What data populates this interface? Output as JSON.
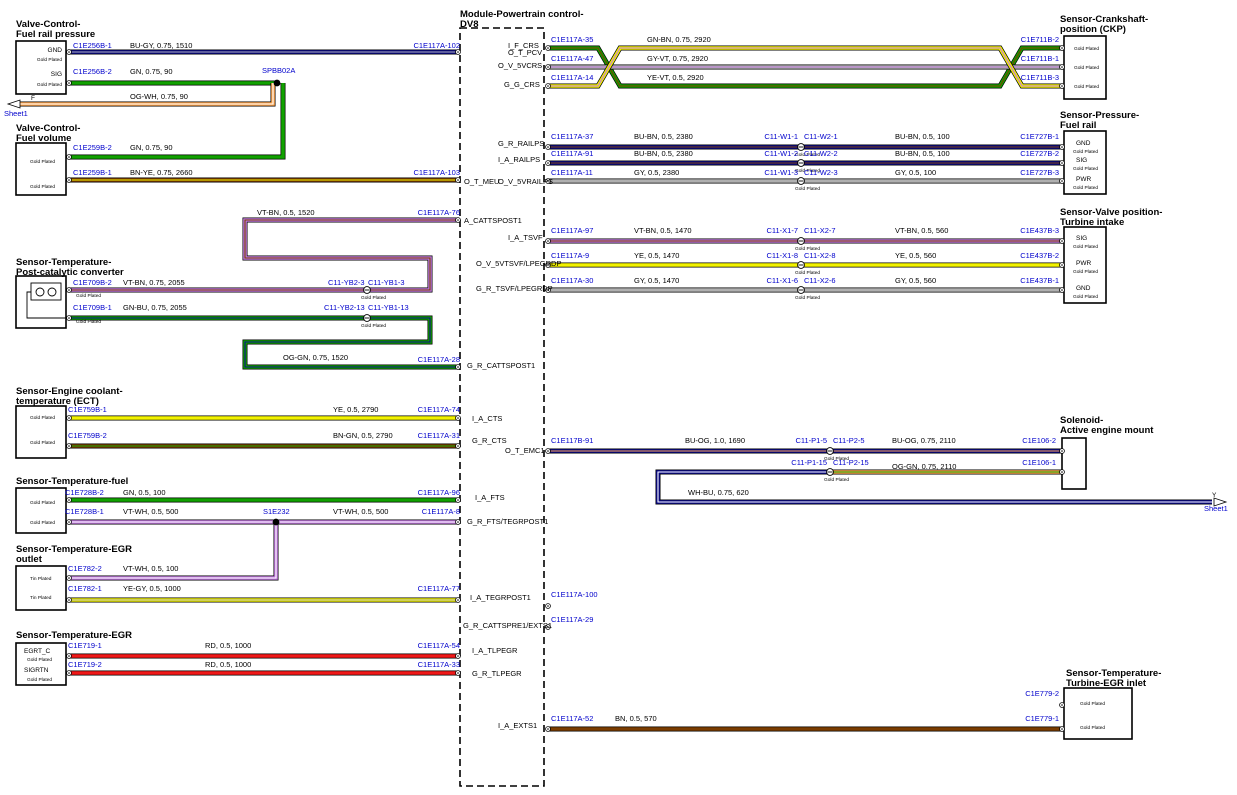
{
  "module": {
    "title": [
      "Module-Powertrain control-",
      "DV8"
    ]
  },
  "components": [
    {
      "id": "frp",
      "title": [
        "Valve-Control-",
        "Fuel rail pressure"
      ],
      "pins": [
        "GND",
        "Gold Plated",
        "SIG",
        "Gold Plated"
      ]
    },
    {
      "id": "fv",
      "title": [
        "Valve-Control-",
        "Fuel volume"
      ],
      "pins": [
        "Gold Plated",
        "Gold Plated"
      ]
    },
    {
      "id": "pcc",
      "title": [
        "Sensor-Temperature-",
        "Post-catalytic converter"
      ],
      "pins": [
        "Gold Plated",
        "Gold Plated"
      ]
    },
    {
      "id": "ect",
      "title": [
        "Sensor-Engine coolant-",
        "temperature (ECT)"
      ],
      "pins": [
        "Gold Plated",
        "Gold Plated"
      ]
    },
    {
      "id": "tf",
      "title": [
        "Sensor-Temperature-fuel"
      ],
      "pins": [
        "Gold Plated",
        "Gold Plated"
      ]
    },
    {
      "id": "egro",
      "title": [
        "Sensor-Temperature-EGR",
        "outlet"
      ],
      "pins": [
        "Tin Plated",
        "Tin Plated"
      ]
    },
    {
      "id": "egr",
      "title": [
        "Sensor-Temperature-EGR"
      ],
      "pins": [
        "EGRT_C",
        "Gold Plated",
        "SIGRTN",
        "Gold Plated"
      ]
    },
    {
      "id": "ckp",
      "title": [
        "Sensor-Crankshaft-",
        "position (CKP)"
      ],
      "pins": [
        "Gold Plated",
        "Gold Plated",
        "Gold Plated"
      ]
    },
    {
      "id": "fr",
      "title": [
        "Sensor-Pressure-",
        "Fuel rail"
      ],
      "pins": [
        "GND",
        "Gold Plated",
        "SIG",
        "Gold Plated",
        "PWR",
        "Gold Plated"
      ]
    },
    {
      "id": "vpt",
      "title": [
        "Sensor-Valve position-",
        "Turbine intake"
      ],
      "pins": [
        "SIG",
        "Gold Plated",
        "PWR",
        "Gold Plated",
        "GND",
        "Gold Plated"
      ]
    },
    {
      "id": "aem",
      "title": [
        "Solenoid-",
        "Active engine mount"
      ],
      "pins": []
    },
    {
      "id": "tegri",
      "title": [
        "Sensor-Temperature-",
        "Turbine-EGR inlet"
      ],
      "pins": [
        "Gold Plated",
        "Gold Plated"
      ]
    }
  ],
  "refs": [
    "C1E256B-1",
    "C1E117A-102",
    "C1E256B-2",
    "SPBB02A",
    "C1E259B-2",
    "C1E259B-1",
    "C1E117A-103",
    "C1E117A-76",
    "C1E709B-2",
    "C11-YB2-3",
    "C11-YB1-3",
    "C11-YB2-13",
    "C11-YB1-13",
    "C1E709B-1",
    "C1E117A-28",
    "C1E759B-1",
    "C1E117A-74",
    "C1E759B-2",
    "C1E117A-31",
    "C1E728B-2",
    "C1E117A-96",
    "C1E728B-1",
    "S1E232",
    "C1E117A-8",
    "C1E782-2",
    "C1E782-1",
    "C1E117A-77",
    "C1E719-1",
    "C1E117A-54",
    "C1E719-2",
    "C1E117A-33",
    "C1E117A-35",
    "C1E711B-2",
    "C1E117A-47",
    "C1E711B-1",
    "C1E117A-14",
    "C1E711B-3",
    "C1E117A-37",
    "C11-W1-1",
    "C11-W2-1",
    "C1E727B-1",
    "C1E117A-91",
    "C11-W1-2",
    "C11-W2-2",
    "C1E727B-2",
    "C1E117A-11",
    "C11-W1-3",
    "C11-W2-3",
    "C1E727B-3",
    "C1E117A-97",
    "C11-X1-7",
    "C11-X2-7",
    "C1E437B-3",
    "C1E117A-9",
    "C11-X1-8",
    "C11-X2-8",
    "C1E437B-2",
    "C1E117A-30",
    "C11-X1-6",
    "C11-X2-6",
    "C1E437B-1",
    "C1E117B-91",
    "C11-P1-5",
    "C11-P2-5",
    "C1E106-2",
    "C11-P1-15",
    "C11-P2-15",
    "C1E106-1",
    "C1E117A-100",
    "C1E117A-29",
    "C1E779-2",
    "C1E117A-52",
    "C1E779-1",
    "Sheet1",
    "Sheet1"
  ],
  "wire_labels": [
    "BU-GY, 0.75, 1510",
    "GN, 0.75, 90",
    "OG-WH, 0.75, 90",
    "GN, 0.75, 90",
    "BN-YE, 0.75, 2660",
    "VT-BN, 0.5, 1520",
    "VT-BN, 0.75, 2055",
    "GN-BU, 0.75, 2055",
    "OG-GN, 0.75, 1520",
    "YE, 0.5, 2790",
    "BN-GN, 0.5, 2790",
    "GN, 0.5, 100",
    "VT-WH, 0.5, 500",
    "VT-WH, 0.5, 500",
    "VT-WH, 0.5, 100",
    "YE-GY, 0.5, 1000",
    "RD, 0.5, 1000",
    "RD, 0.5, 1000",
    "GN-BN, 0.75, 2920",
    "GY-VT, 0.75, 2920",
    "YE-VT, 0.5, 2920",
    "BU-BN, 0.5, 2380",
    "BU-BN, 0.5, 100",
    "BU-BN, 0.5, 2380",
    "BU-BN, 0.5, 100",
    "GY, 0.5, 2380",
    "GY, 0.5, 100",
    "VT-BN, 0.5, 1470",
    "VT-BN, 0.5, 560",
    "YE, 0.5, 1470",
    "YE, 0.5, 560",
    "GY, 0.5, 1470",
    "GY, 0.5, 560",
    "BU-OG, 1.0, 1690",
    "BU-OG, 0.75, 2110",
    "OG-GN, 0.75, 2110",
    "WH-BU, 0.75, 620",
    "BN, 0.5, 570"
  ],
  "signals": [
    "O_T_PCV",
    "O_T_MEU",
    "O_V_5VRAILPS",
    "A_CATTSPOST1",
    "G_R_CATTSPOST1",
    "I_A_CTS",
    "G_R_CTS",
    "I_A_FTS",
    "G_R_FTS/TEGRPOST1",
    "I_A_TEGRPOST1",
    "G_R_CATTSPRE1/EXTS1",
    "I_A_TLPEGR",
    "G_R_TLPEGR",
    "I_F_CRS",
    "O_V_5VCRS",
    "G_G_CRS",
    "G_R_RAILPS",
    "I_A_RAILPS",
    "I_A_TSVF",
    "O_V_5VTSVF/LPEGRDP",
    "G_R_TSVF/LPEGRDP",
    "O_T_EMC1",
    "I_A_EXTS1"
  ],
  "misc": [
    "F",
    "Y",
    "Gold Plated"
  ],
  "colors": {
    "BU": "#0b0b8c",
    "GN": "#11a100",
    "OG": "#ffa64d",
    "VT": "#c27ae0",
    "BN": "#7a3c00",
    "YE": "#f2f200",
    "GY": "#b0b0b0",
    "RD": "#f01818",
    "WH": "#ffffff",
    "ref_text": "#0000cc"
  }
}
